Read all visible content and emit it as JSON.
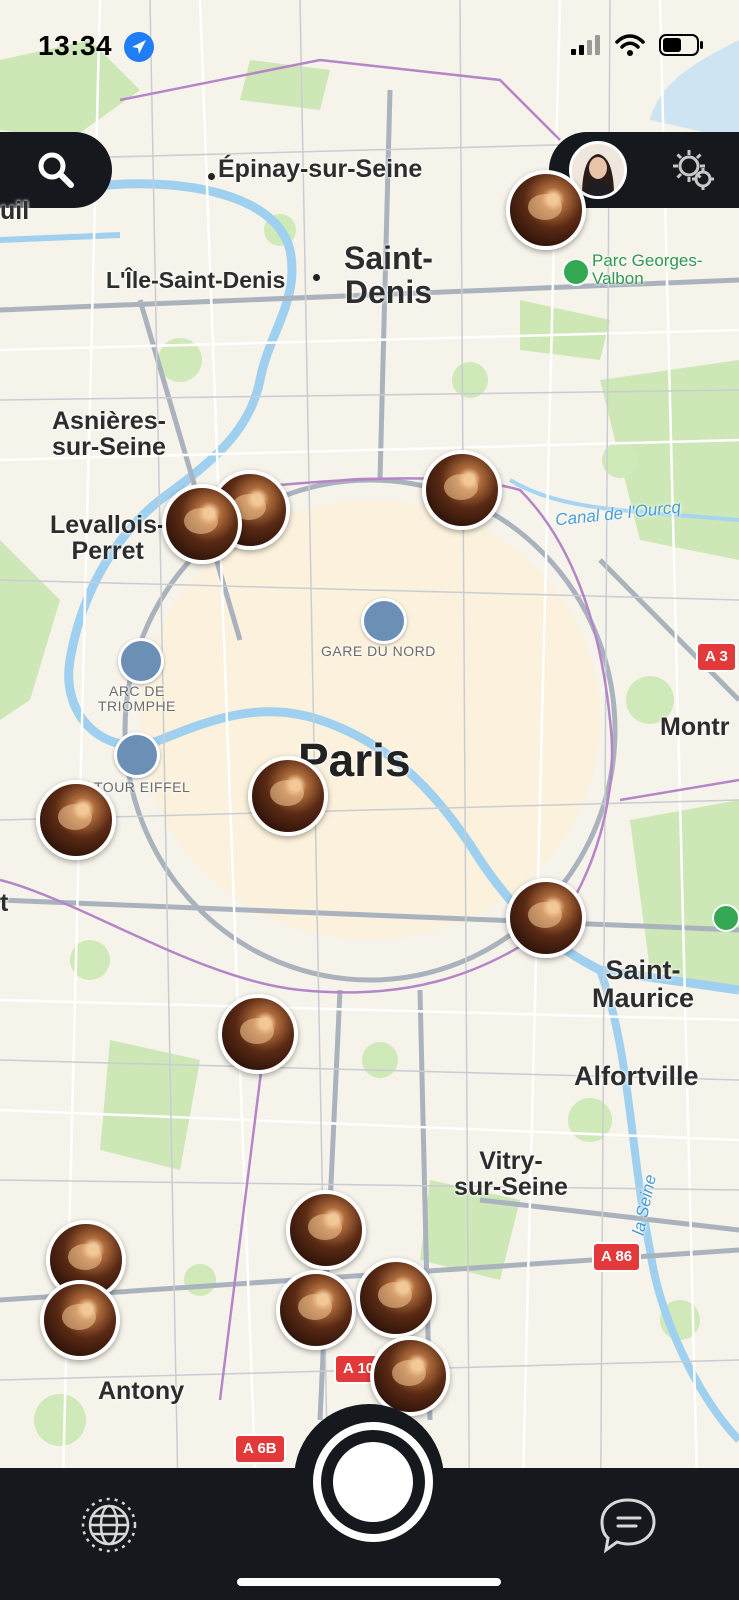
{
  "status_bar": {
    "time": "13:34"
  },
  "map": {
    "labels": {
      "epinay": "Épinay-sur-Seine",
      "saint_denis": "Saint-\nDenis",
      "ile_saint_denis": "L'Île-Saint-Denis",
      "parc_georges": "Parc Georges-\nValbon",
      "asnieres": "Asnières-\nsur-Seine",
      "levallois": "Levallois-\nPerret",
      "canal": "Canal de l'Ourcq",
      "gare_du_nord": "GARE DU NORD",
      "arc": "ARC DE\nTRIOMPHE",
      "tour_eiffel": "TOUR EIFFEL",
      "paris": "Paris",
      "montr": "Montr",
      "saint_maurice": "Saint-\nMaurice",
      "alfortville": "Alfortville",
      "vitry": "Vitry-\nsur-Seine",
      "la_seine": "la Seine",
      "antony": "Antony",
      "rueil_edge": "uil",
      "left_edge": "t"
    },
    "road_shields": {
      "a3": "A 3",
      "a86": "A 86",
      "a10": "A 10",
      "a6b": "A 6B"
    },
    "pins_count": 15
  },
  "icons": {
    "search": "search-icon",
    "settings": "gear-icon",
    "globe": "globe-icon",
    "chat": "chat-bubble-icon",
    "location": "location-arrow-icon"
  },
  "colors": {
    "bar_bg": "#15191d",
    "accent": "#1f7ef5"
  }
}
